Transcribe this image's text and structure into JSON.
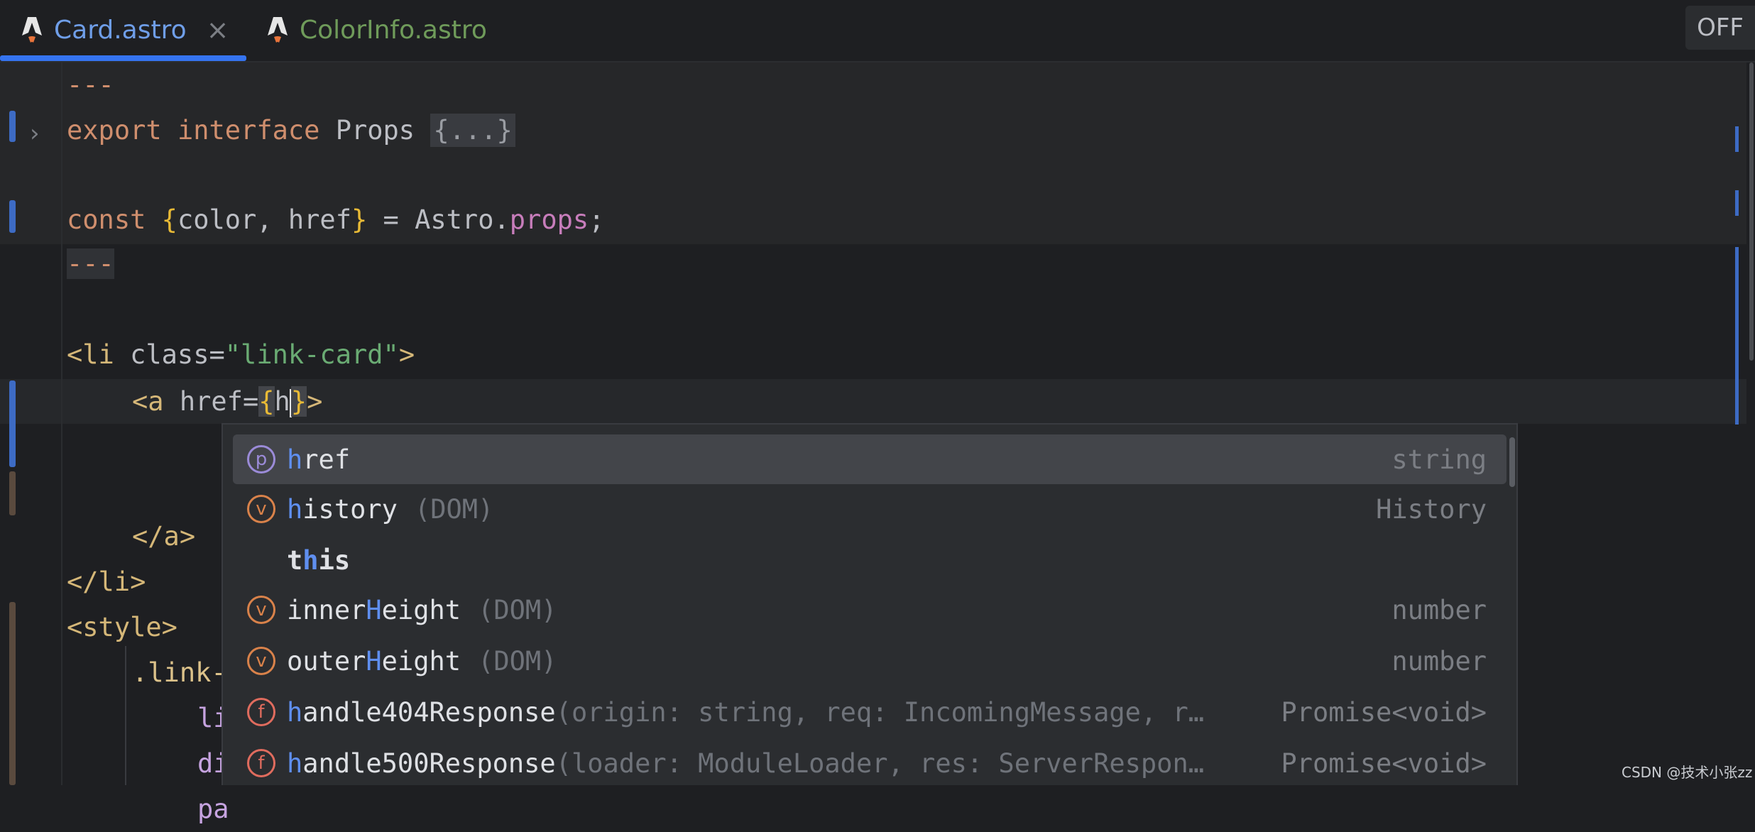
{
  "tabs": [
    {
      "label": "Card.astro",
      "active": true,
      "close_glyph": "×"
    },
    {
      "label": "ColorInfo.astro",
      "active": false
    }
  ],
  "badge_off": "OFF",
  "code": {
    "fence": "---",
    "line2": {
      "kw1": "export",
      "kw2": "interface",
      "name": "Props",
      "folded": "{...}"
    },
    "line4": {
      "kw": "const",
      "open": "{",
      "params": "color, href",
      "close": "}",
      "eq": " = Astro.",
      "prop": "props",
      "semi": ";"
    },
    "line7": {
      "open": "<li",
      "attr": " class=",
      "value": "\"link-card\"",
      "close": ">"
    },
    "line8": {
      "open": "<a",
      "attr": " href=",
      "brace_open": "{",
      "typed": "h",
      "brace_close": "}",
      "close": ">"
    },
    "line10": "</a>",
    "line11": "</li>",
    "line12": "<style>",
    "line13": ".link-",
    "line14": "li",
    "line15": "di",
    "line16": "pa"
  },
  "completion": {
    "items": [
      {
        "kind": "p",
        "match": "h",
        "rest": "ref",
        "hint": "",
        "type": "string"
      },
      {
        "kind": "v",
        "match": "h",
        "rest": "istory",
        "hint": "(DOM)",
        "type": "History"
      },
      {
        "kind": "",
        "pre": "t",
        "match": "h",
        "rest": "is",
        "hint": "",
        "type": ""
      },
      {
        "kind": "v",
        "pre": "inner",
        "match": "H",
        "rest": "eight",
        "hint": "(DOM)",
        "type": "number"
      },
      {
        "kind": "v",
        "pre": "outer",
        "match": "H",
        "rest": "eight",
        "hint": "(DOM)",
        "type": "number"
      },
      {
        "kind": "f",
        "match": "h",
        "rest": "andle404Response",
        "hint": "(origin: string, req: IncomingMessage, r…",
        "type": "Promise<void>"
      },
      {
        "kind": "f",
        "match": "h",
        "rest": "andle500Response",
        "hint": "(loader: ModuleLoader, res: ServerRespon…",
        "type": "Promise<void>"
      }
    ]
  },
  "watermark": "CSDN @技术小张zz"
}
